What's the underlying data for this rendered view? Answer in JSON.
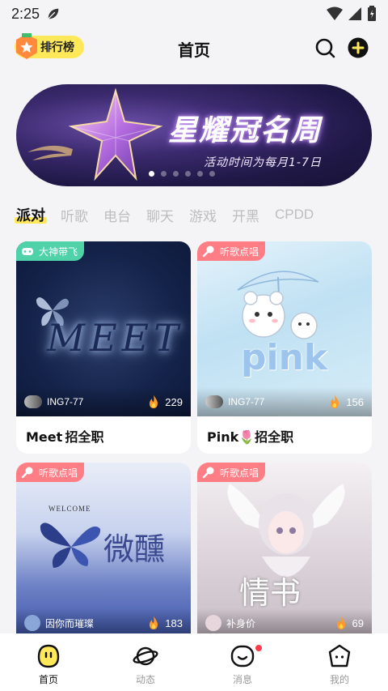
{
  "status_bar": {
    "time": "2:25"
  },
  "header": {
    "rank_label": "排行榜",
    "title": "首页"
  },
  "banner": {
    "title": "星耀冠名周",
    "subtitle": "活动时间为每月1-7日",
    "dot_count": 6,
    "active_dot": 0
  },
  "tabs": [
    {
      "label": "派对",
      "active": true
    },
    {
      "label": "听歌",
      "active": false
    },
    {
      "label": "电台",
      "active": false
    },
    {
      "label": "聊天",
      "active": false
    },
    {
      "label": "游戏",
      "active": false
    },
    {
      "label": "开黑",
      "active": false
    },
    {
      "label": "CPDD",
      "active": false
    }
  ],
  "rooms": [
    {
      "tag": "大神带飞",
      "tag_color": "#4fd2a7",
      "owner": "ING7-77",
      "heat": "229",
      "name": "Meet  招全职",
      "art_text": "MEET"
    },
    {
      "tag": "听歌点唱",
      "tag_color": "#ff7e86",
      "owner": "ING7-77",
      "heat": "156",
      "name": "Pink🌷招全职",
      "art_text": "pink"
    },
    {
      "tag": "听歌点唱",
      "tag_color": "#ff7e86",
      "owner": "因你而璀璨",
      "heat": "183",
      "name": "",
      "art_text": "微醺",
      "art_subtext": "WELCOME"
    },
    {
      "tag": "听歌点唱",
      "tag_color": "#ff7e86",
      "owner": "补身价",
      "heat": "69",
      "name": "",
      "art_text": "情书"
    }
  ],
  "bottom_nav": [
    {
      "label": "首页",
      "icon": "home-face-icon",
      "active": true
    },
    {
      "label": "动态",
      "icon": "planet-icon",
      "active": false
    },
    {
      "label": "消息",
      "icon": "message-face-icon",
      "active": false,
      "badge": true
    },
    {
      "label": "我的",
      "icon": "profile-face-icon",
      "active": false
    }
  ]
}
